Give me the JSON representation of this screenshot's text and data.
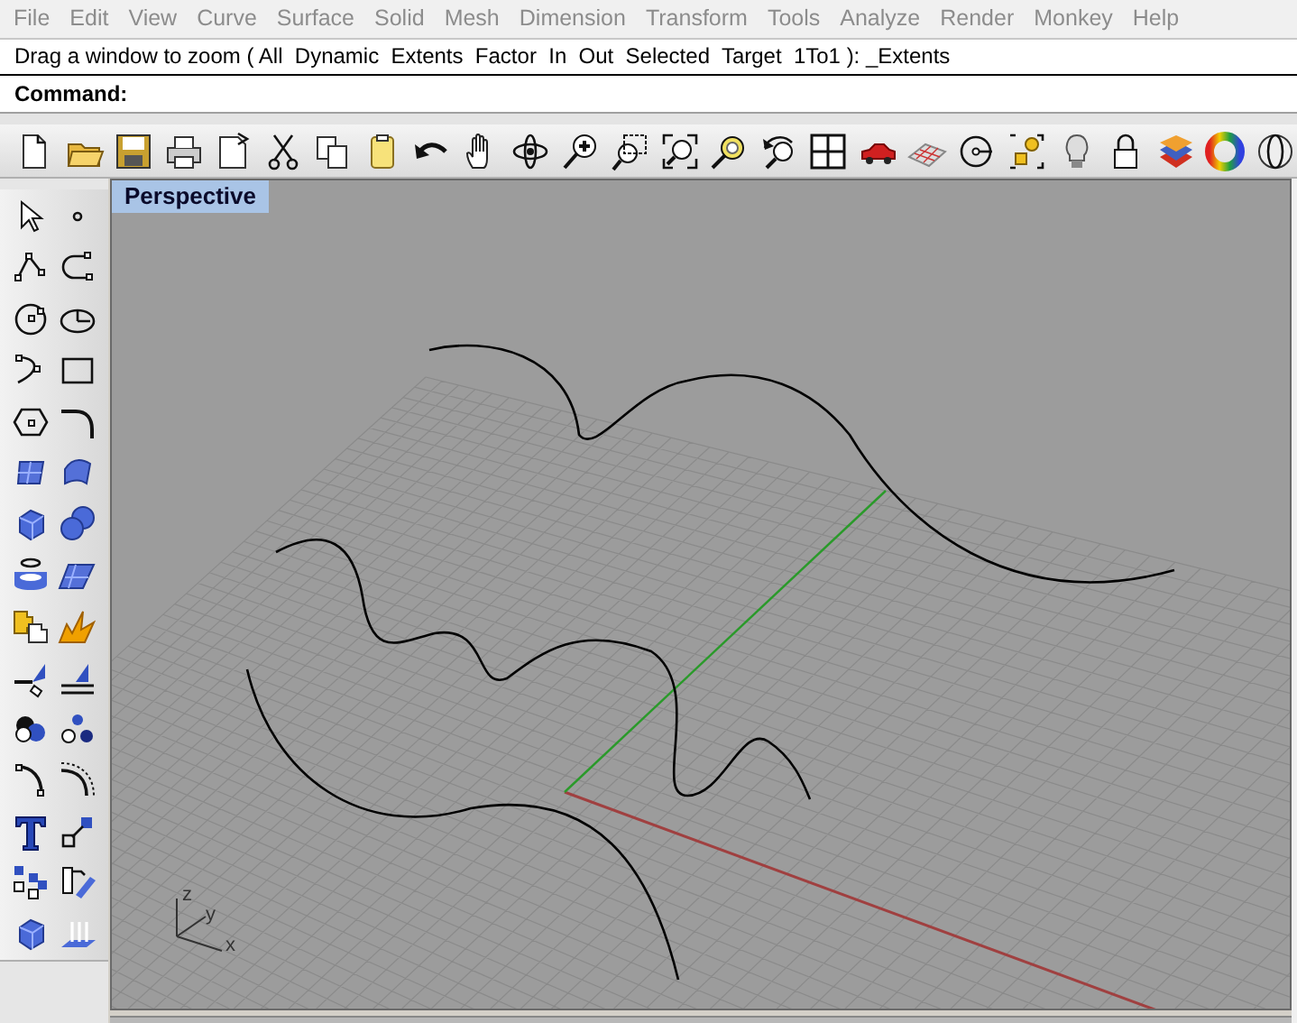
{
  "menu_bar": {
    "items": [
      "File",
      "Edit",
      "View",
      "Curve",
      "Surface",
      "Solid",
      "Mesh",
      "Dimension",
      "Transform",
      "Tools",
      "Analyze",
      "Render",
      "Monkey",
      "Help"
    ]
  },
  "command_area": {
    "history": "Drag a window to zoom ( All  Dynamic  Extents  Factor  In  Out  Selected  Target  1To1 ): _Extents",
    "prompt": "Command:"
  },
  "viewport": {
    "title": "Perspective",
    "axis_labels": [
      "z",
      "y",
      "x"
    ]
  }
}
